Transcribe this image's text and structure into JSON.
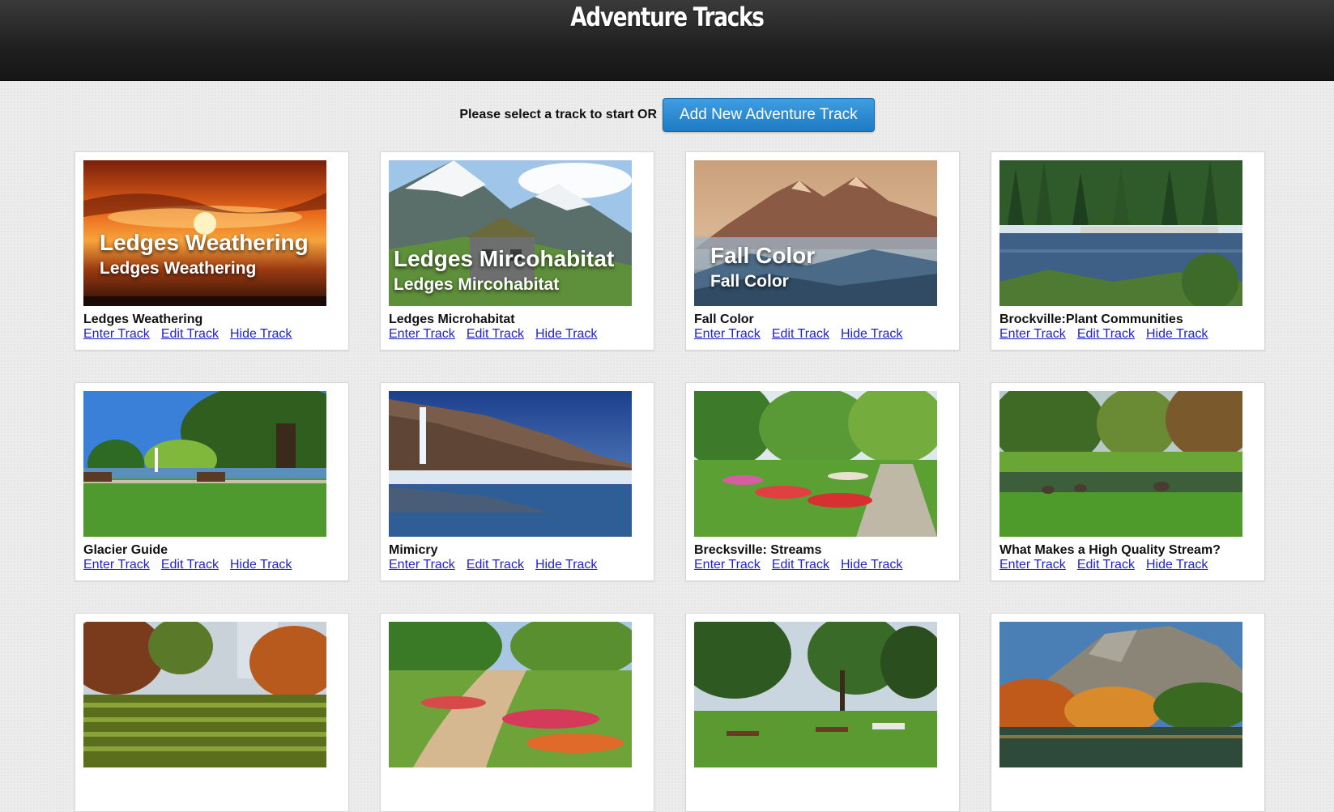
{
  "header": {
    "title": "Adventure Tracks"
  },
  "toolbar": {
    "prompt": "Please select a track to start OR",
    "add_label": "Add New Adventure Track"
  },
  "link_labels": {
    "enter": "Enter Track",
    "edit": "Edit Track",
    "hide": "Hide Track"
  },
  "tracks": [
    {
      "title": "Ledges Weathering",
      "overlay_main": "Ledges Weathering",
      "overlay_sub": "Ledges Weathering",
      "scene": "sunset"
    },
    {
      "title": "Ledges Microhabitat",
      "overlay_main": "Ledges Mircohabitat",
      "overlay_sub": "Ledges Mircohabitat",
      "scene": "cabin-mountain"
    },
    {
      "title": "Fall Color",
      "overlay_main": "Fall Color",
      "overlay_sub": "Fall Color",
      "scene": "misty-peaks"
    },
    {
      "title": "Brockville:Plant Communities",
      "scene": "lake-pier"
    },
    {
      "title": "Glacier Guide",
      "scene": "park-fountain"
    },
    {
      "title": "Mimicry",
      "scene": "cliff-reflection"
    },
    {
      "title": "Brecksville: Streams",
      "scene": "formal-garden"
    },
    {
      "title": "What Makes a High Quality Stream?",
      "scene": "geese-pond"
    },
    {
      "scene": "hedge-maze"
    },
    {
      "scene": "garden-path"
    },
    {
      "scene": "picnic-park"
    },
    {
      "scene": "autumn-cliff"
    }
  ]
}
